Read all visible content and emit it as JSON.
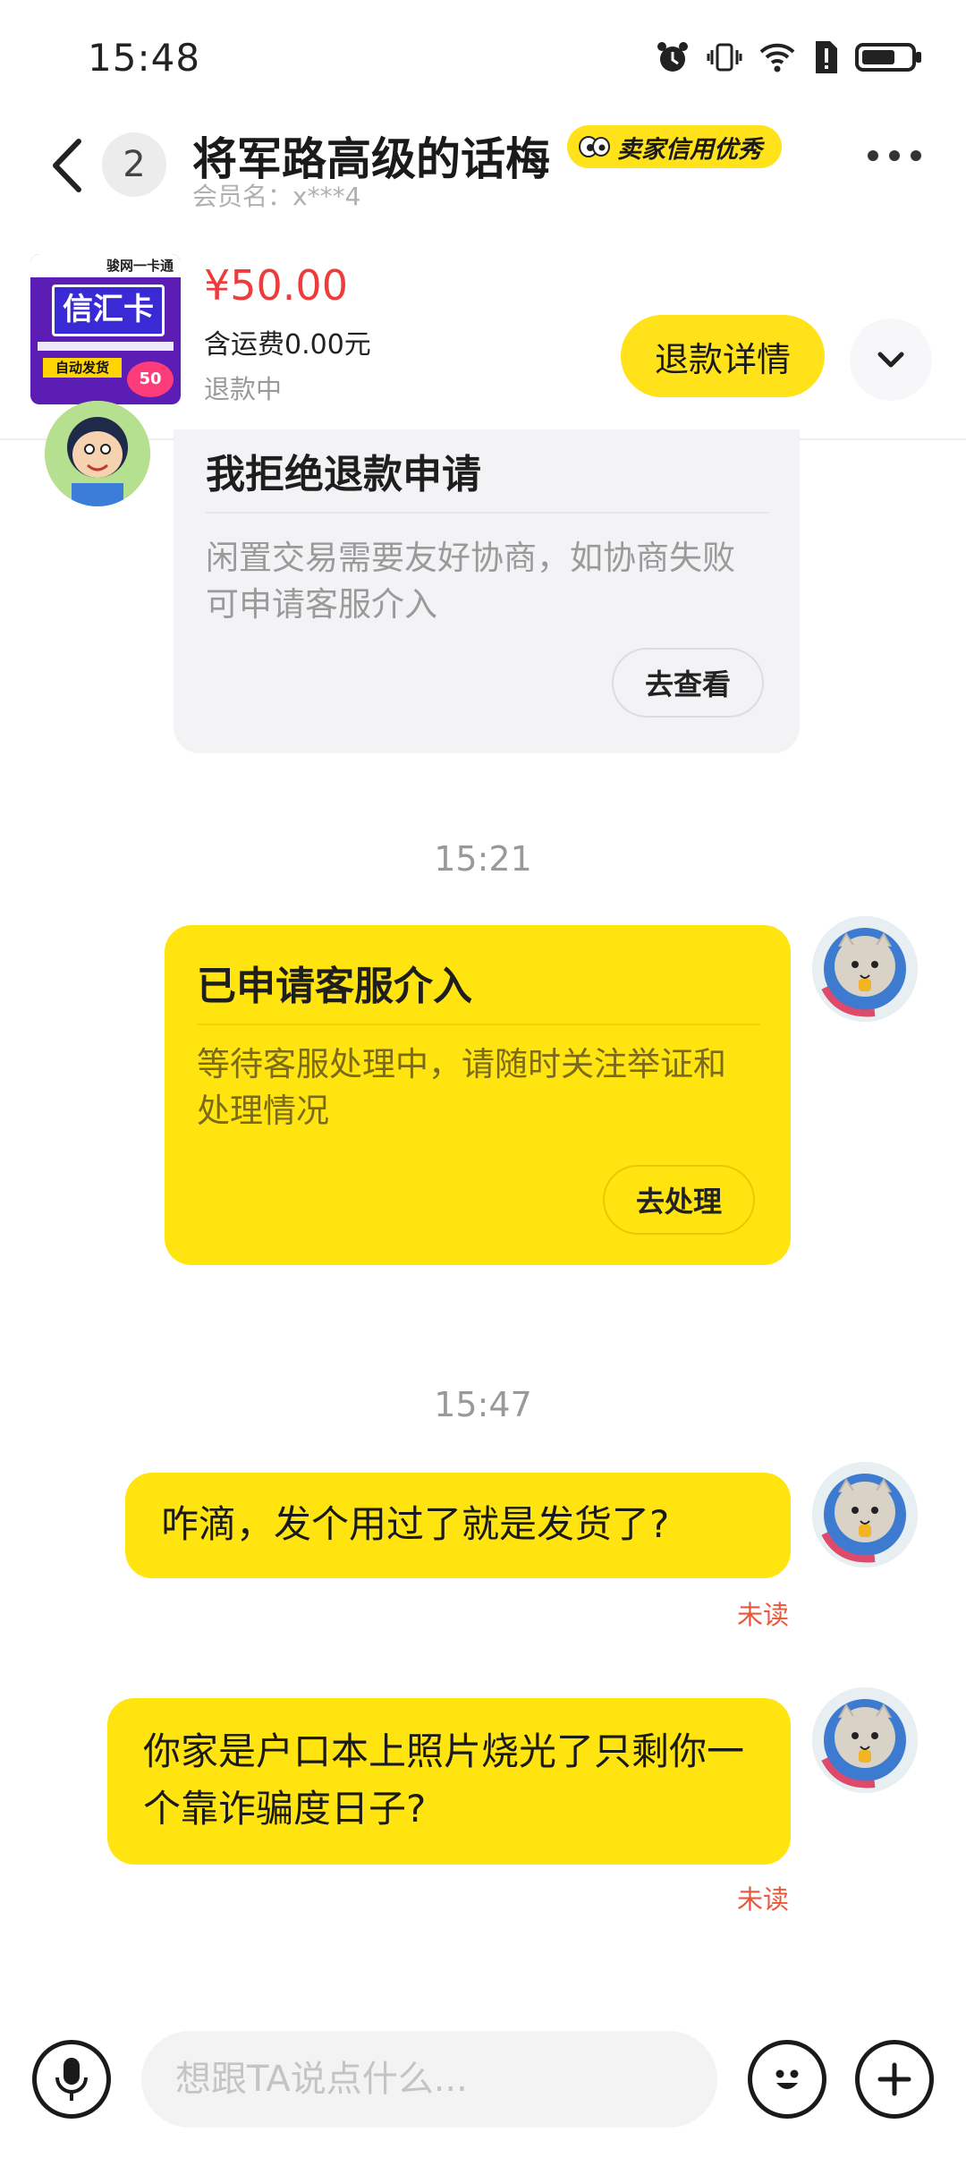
{
  "status": {
    "time": "15:48"
  },
  "header": {
    "unread_count": "2",
    "title": "将军路高级的话梅",
    "credit_badge": "卖家信用优秀",
    "member_name": "会员名：x***4"
  },
  "product": {
    "thumb_brand": "骏网一卡通",
    "thumb_card": "信汇卡",
    "thumb_auto": "自动发货",
    "thumb_value": "50",
    "price": "¥50.00",
    "shipping": "含运费0.00元",
    "status": "退款中",
    "refund_button": "退款详情"
  },
  "messages": {
    "seller_card": {
      "title": "我拒绝退款申请",
      "body": "闲置交易需要友好协商，如协商失败可申请客服介入",
      "button": "去查看"
    },
    "ts1": "15:21",
    "my_card": {
      "title": "已申请客服介入",
      "body": "等待客服处理中，请随时关注举证和处理情况",
      "button": "去处理"
    },
    "ts2": "15:47",
    "msg1": {
      "text": "咋滴，发个用过了就是发货了?",
      "status": "未读"
    },
    "msg2": {
      "text": "你家是户口本上照片烧光了只剩你一个靠诈骗度日子?",
      "status": "未读"
    }
  },
  "input": {
    "placeholder": "想跟TA说点什么..."
  }
}
